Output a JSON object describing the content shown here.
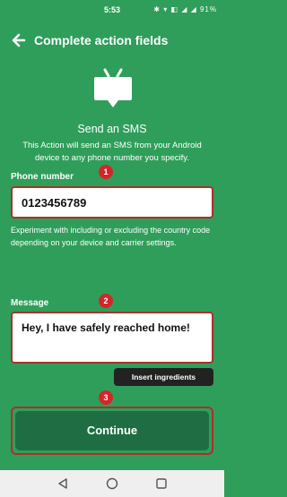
{
  "status_bar": {
    "time": "5:53",
    "icons": "✱ ▾ ◧ ◢ ◢",
    "battery": "91%"
  },
  "header": {
    "title": "Complete action fields",
    "back_icon": "arrow-left"
  },
  "action": {
    "title": "Send an SMS",
    "description": "This Action will send an SMS from your Android device to any phone number you specify."
  },
  "phone_field": {
    "label": "Phone number",
    "value": "0123456789",
    "hint": "Experiment with including or excluding the country code depending on your device and carrier settings.",
    "badge": "1"
  },
  "message_field": {
    "label": "Message",
    "value": "Hey, I have safely reached home!",
    "badge": "2"
  },
  "insert_ingredients_label": "Insert ingredients",
  "continue": {
    "label": "Continue",
    "badge": "3"
  },
  "colors": {
    "background": "#2f9e5a",
    "button": "#1f6e43",
    "highlight": "#a8312f",
    "badge": "#d3262a"
  }
}
